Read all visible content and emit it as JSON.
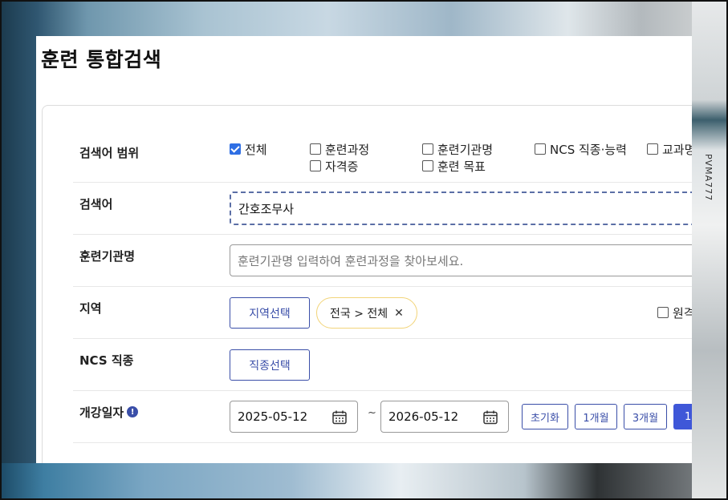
{
  "page": {
    "title": "훈련 통합검색"
  },
  "scope": {
    "label": "검색어 범위",
    "options": [
      {
        "label": "전체",
        "checked": true
      },
      {
        "label": "훈련과정",
        "checked": false
      },
      {
        "label": "훈련기관명",
        "checked": false
      },
      {
        "label": "NCS 직종·능력",
        "checked": false
      },
      {
        "label": "교과명",
        "checked": false
      },
      {
        "label": "자격증",
        "checked": false
      },
      {
        "label": "훈련 목표",
        "checked": false
      }
    ]
  },
  "keyword": {
    "label": "검색어",
    "value": "간호조무사"
  },
  "institution": {
    "label": "훈련기관명",
    "placeholder": "훈련기관명 입력하여 훈련과정을 찾아보세요."
  },
  "region": {
    "label": "지역",
    "button": "지역선택",
    "chip": "전국 > 전체",
    "chip_remove": "✕",
    "remote_label": "원격"
  },
  "ncs": {
    "label": "NCS 직종",
    "button": "직종선택"
  },
  "period": {
    "label": "개강일자",
    "info": "!",
    "start": "2025-05-12",
    "separator": "~",
    "end": "2026-05-12",
    "buttons": [
      "초기화",
      "1개월",
      "3개월"
    ],
    "partial_button": "1"
  },
  "background": {
    "side_label": "PVMA777"
  },
  "colors": {
    "accent": "#3a4ea8",
    "checkbox": "#2f6fe4",
    "chip_border": "#f2d479"
  }
}
